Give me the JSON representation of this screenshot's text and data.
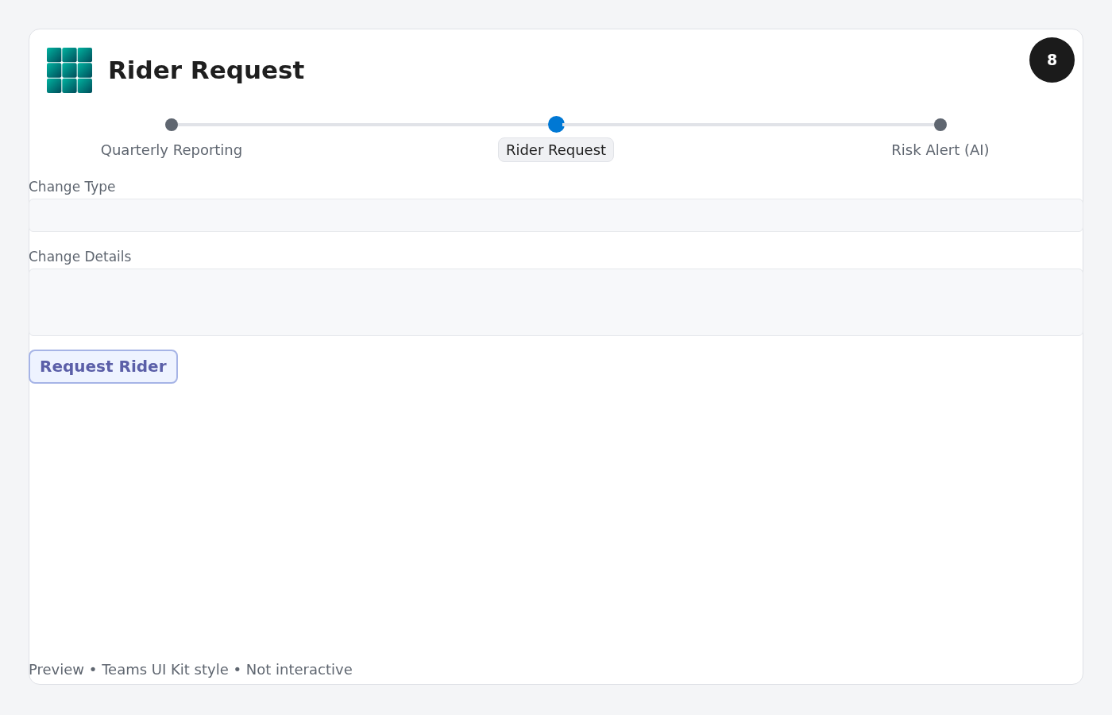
{
  "header": {
    "title": "Rider Request",
    "badge": "8"
  },
  "steps": [
    {
      "label": "Quarterly Reporting",
      "selected": false
    },
    {
      "label": "Rider Request",
      "selected": true
    },
    {
      "label": "Risk Alert (AI)",
      "selected": false
    }
  ],
  "fields": [
    {
      "label": "Change Type",
      "kind": "input"
    },
    {
      "label": "Change Details",
      "kind": "textarea"
    }
  ],
  "button": "Request Rider",
  "footer": "Preview • Teams UI Kit style • Not interactive"
}
